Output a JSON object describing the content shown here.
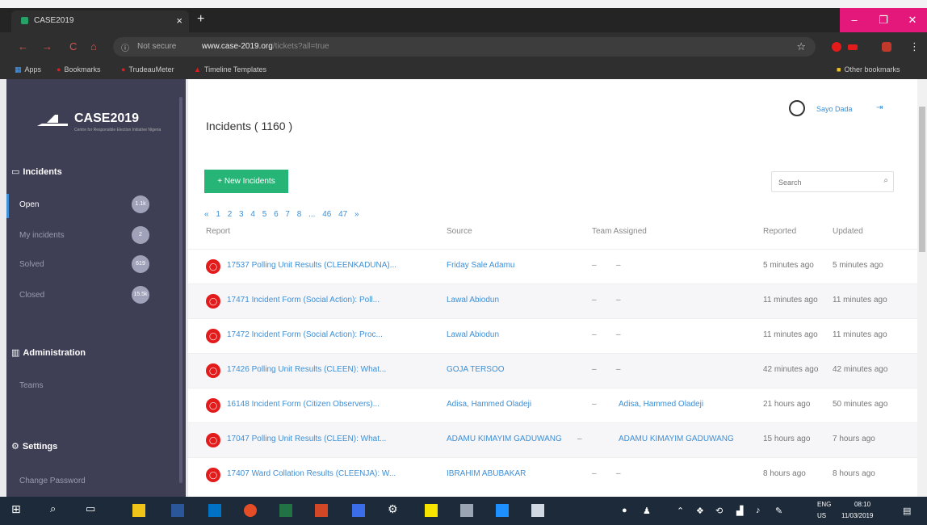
{
  "browser": {
    "tab_title": "CASE2019",
    "tab_close": "×",
    "new_tab": "+",
    "window_controls": [
      "–",
      "❐",
      "✕"
    ],
    "nav": {
      "back": "←",
      "forward": "→",
      "reload": "C",
      "home": "⌂"
    },
    "security_label": "Not secure",
    "url_host": "www.case-2019.org",
    "url_path": "/tickets?all=true",
    "star": "☆",
    "bookmarks": [
      "Apps",
      "Bookmarks",
      "TrudeauMeter",
      "Timeline Templates"
    ],
    "other_bookmarks": "Other bookmarks"
  },
  "sidebar": {
    "logo_text": "CASE2019",
    "logo_sub": "Centre for Responsible Election Initiative Nigeria",
    "incidents_title": "Incidents",
    "items": [
      {
        "label": "Open",
        "badge": "1.1k"
      },
      {
        "label": "My incidents",
        "badge": "2"
      },
      {
        "label": "Solved",
        "badge": "619"
      },
      {
        "label": "Closed",
        "badge": "15.5k"
      }
    ],
    "admin_title": "Administration",
    "admin_items": [
      "Teams"
    ],
    "settings_title": "Settings",
    "settings_items": [
      "Change Password"
    ]
  },
  "main": {
    "title": "Incidents ( 1160 )",
    "user_name": "Sayo Dada",
    "new_button": "+ New Incidents",
    "search_placeholder": "Search",
    "pagination": [
      "«",
      "1",
      "2",
      "3",
      "4",
      "5",
      "6",
      "7",
      "8",
      "...",
      "46",
      "47",
      "»"
    ],
    "columns": [
      "Report",
      "Source",
      "Team Assigned",
      "Reported",
      "Updated"
    ],
    "rows": [
      {
        "report": "17537 Polling Unit Results (CLEENKADUNA)...",
        "source": "Friday Sale Adamu",
        "team_dash": "–",
        "team": "–",
        "reported": "5 minutes ago",
        "updated": "5 minutes ago"
      },
      {
        "report": "17471 Incident Form (Social Action): Poll...",
        "source": "Lawal Abiodun",
        "team_dash": "–",
        "team": "–",
        "reported": "11 minutes ago",
        "updated": "11 minutes ago"
      },
      {
        "report": "17472 Incident Form (Social Action): Proc...",
        "source": "Lawal Abiodun",
        "team_dash": "–",
        "team": "–",
        "reported": "11 minutes ago",
        "updated": "11 minutes ago"
      },
      {
        "report": "17426 Polling Unit Results (CLEEN): What...",
        "source": "GOJA TERSOO",
        "team_dash": "–",
        "team": "–",
        "reported": "42 minutes ago",
        "updated": "42 minutes ago"
      },
      {
        "report": "16148 Incident Form (Citizen Observers)...",
        "source": "Adisa, Hammed Oladeji",
        "team_dash": "–",
        "team": "Adisa, Hammed Oladeji",
        "reported": "21 hours ago",
        "updated": "50 minutes ago"
      },
      {
        "report": "17047 Polling Unit Results (CLEEN): What...",
        "source": "ADAMU KIMAYIM GADUWANG",
        "team_dash": "–",
        "team": "ADAMU KIMAYIM GADUWANG",
        "reported": "15 hours ago",
        "updated": "7 hours ago"
      },
      {
        "report": "17407 Ward Collation Results (CLEENJA): W...",
        "source": "IBRAHIM ABUBAKAR",
        "team_dash": "–",
        "team": "–",
        "reported": "8 hours ago",
        "updated": "8 hours ago"
      }
    ]
  },
  "taskbar": {
    "lang_top": "ENG",
    "lang_bottom": "US",
    "time": "08:10",
    "date": "11/03/2019"
  },
  "colors": {
    "sidebar_bg": "#3e3e55",
    "accent_green": "#26b477",
    "link_blue": "#3e8fd6",
    "status_red": "#e31b1b",
    "window_pink": "#e4177a"
  }
}
